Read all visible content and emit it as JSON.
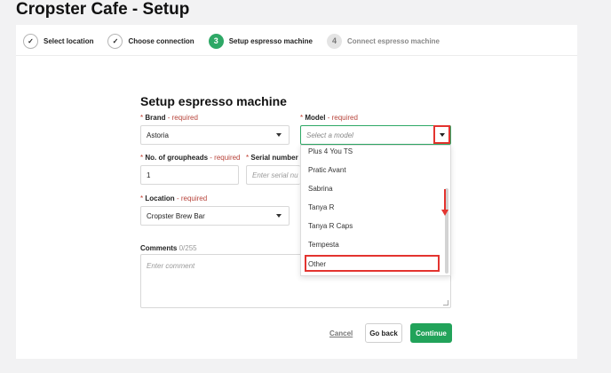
{
  "page": {
    "title": "Cropster Cafe - Setup"
  },
  "stepper": {
    "steps": [
      {
        "marker": "✓",
        "label": "Select location",
        "state": "done"
      },
      {
        "marker": "✓",
        "label": "Choose connection",
        "state": "done"
      },
      {
        "marker": "3",
        "label": "Setup espresso machine",
        "state": "active"
      },
      {
        "marker": "4",
        "label": "Connect espresso machine",
        "state": "pending"
      }
    ]
  },
  "form": {
    "title": "Setup espresso machine",
    "required_text": "- required",
    "star": "*",
    "brand": {
      "label": "Brand",
      "value": "Astoria"
    },
    "model": {
      "label": "Model",
      "placeholder": "Select a model"
    },
    "groupheads": {
      "label": "No. of groupheads",
      "value": "1"
    },
    "serial": {
      "label": "Serial number",
      "placeholder": "Enter serial nu"
    },
    "location": {
      "label": "Location",
      "value": "Cropster Brew Bar"
    },
    "comments": {
      "label": "Comments",
      "count": "0/255",
      "placeholder": "Enter comment"
    }
  },
  "dropdown": {
    "items": [
      "Plus 4 You TS",
      "Pratic Avant",
      "Sabrina",
      "Tanya R",
      "Tanya R Caps",
      "Tempesta",
      "Other"
    ]
  },
  "actions": {
    "cancel": "Cancel",
    "go_back": "Go back",
    "continue": "Continue"
  },
  "colors": {
    "accent": "#22a35a",
    "highlight": "#e3342f",
    "required": "#b7433a"
  }
}
